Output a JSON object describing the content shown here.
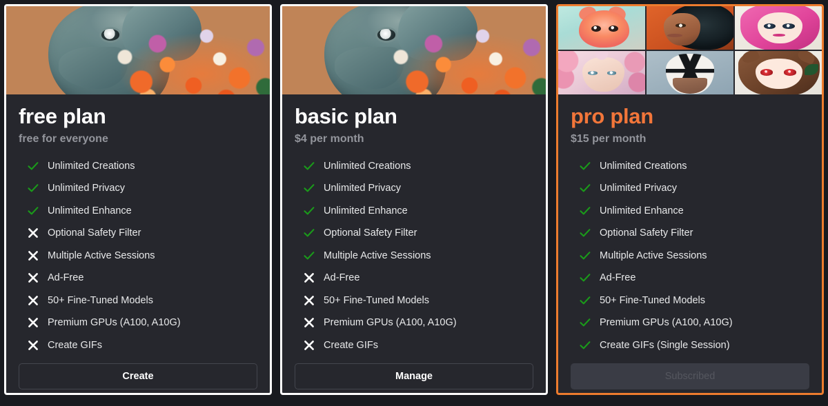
{
  "theme": {
    "page_background": "#181a1f",
    "card_background": "#26272d",
    "card_border": "#ffffff",
    "featured_border": "#ed7c2e",
    "featured_title": "#f2763a",
    "check_color": "#1a9b1a",
    "cross_color": "#ffffff",
    "subtitle_color": "#93959c"
  },
  "plans": [
    {
      "id": "free",
      "title": "free plan",
      "price": "free for everyone",
      "featured": false,
      "hero_type": "single-image",
      "hero_name": "android-portrait-with-flowers-image",
      "action": {
        "label": "Create",
        "name": "create-button",
        "disabled": false
      },
      "features": [
        {
          "label": "Unlimited Creations",
          "icon": "check-icon",
          "included": true
        },
        {
          "label": "Unlimited Privacy",
          "icon": "check-icon",
          "included": true
        },
        {
          "label": "Unlimited Enhance",
          "icon": "check-icon",
          "included": true
        },
        {
          "label": "Optional Safety Filter",
          "icon": "cross-icon",
          "included": false
        },
        {
          "label": "Multiple Active Sessions",
          "icon": "cross-icon",
          "included": false
        },
        {
          "label": "Ad-Free",
          "icon": "cross-icon",
          "included": false
        },
        {
          "label": "50+ Fine-Tuned Models",
          "icon": "cross-icon",
          "included": false
        },
        {
          "label": "Premium GPUs (A100, A10G)",
          "icon": "cross-icon",
          "included": false
        },
        {
          "label": "Create GIFs",
          "icon": "cross-icon",
          "included": false
        }
      ]
    },
    {
      "id": "basic",
      "title": "basic plan",
      "price": "$4 per month",
      "featured": false,
      "hero_type": "single-image",
      "hero_name": "android-portrait-with-flowers-image",
      "action": {
        "label": "Manage",
        "name": "manage-button",
        "disabled": false
      },
      "features": [
        {
          "label": "Unlimited Creations",
          "icon": "check-icon",
          "included": true
        },
        {
          "label": "Unlimited Privacy",
          "icon": "check-icon",
          "included": true
        },
        {
          "label": "Unlimited Enhance",
          "icon": "check-icon",
          "included": true
        },
        {
          "label": "Optional Safety Filter",
          "icon": "check-icon",
          "included": true
        },
        {
          "label": "Multiple Active Sessions",
          "icon": "check-icon",
          "included": true
        },
        {
          "label": "Ad-Free",
          "icon": "cross-icon",
          "included": false
        },
        {
          "label": "50+ Fine-Tuned Models",
          "icon": "cross-icon",
          "included": false
        },
        {
          "label": "Premium GPUs (A100, A10G)",
          "icon": "cross-icon",
          "included": false
        },
        {
          "label": "Create GIFs",
          "icon": "cross-icon",
          "included": false
        }
      ]
    },
    {
      "id": "pro",
      "title": "pro plan",
      "price": "$15 per month",
      "featured": true,
      "hero_type": "image-grid",
      "hero_name": "avatar-gallery-grid",
      "hero_tiles": [
        "pink-cat-character-image",
        "woman-portrait-image",
        "pink-haired-anime-girl-image",
        "floral-fantasy-portrait-image",
        "masked-figure-image",
        "brown-haired-anime-girl-image"
      ],
      "action": {
        "label": "Subscribed",
        "name": "subscribed-button",
        "disabled": true
      },
      "features": [
        {
          "label": "Unlimited Creations",
          "icon": "check-icon",
          "included": true
        },
        {
          "label": "Unlimited Privacy",
          "icon": "check-icon",
          "included": true
        },
        {
          "label": "Unlimited Enhance",
          "icon": "check-icon",
          "included": true
        },
        {
          "label": "Optional Safety Filter",
          "icon": "check-icon",
          "included": true
        },
        {
          "label": "Multiple Active Sessions",
          "icon": "check-icon",
          "included": true
        },
        {
          "label": "Ad-Free",
          "icon": "check-icon",
          "included": true
        },
        {
          "label": "50+ Fine-Tuned Models",
          "icon": "check-icon",
          "included": true
        },
        {
          "label": "Premium GPUs (A100, A10G)",
          "icon": "check-icon",
          "included": true
        },
        {
          "label": "Create GIFs (Single Session)",
          "icon": "check-icon",
          "included": true
        }
      ]
    }
  ]
}
